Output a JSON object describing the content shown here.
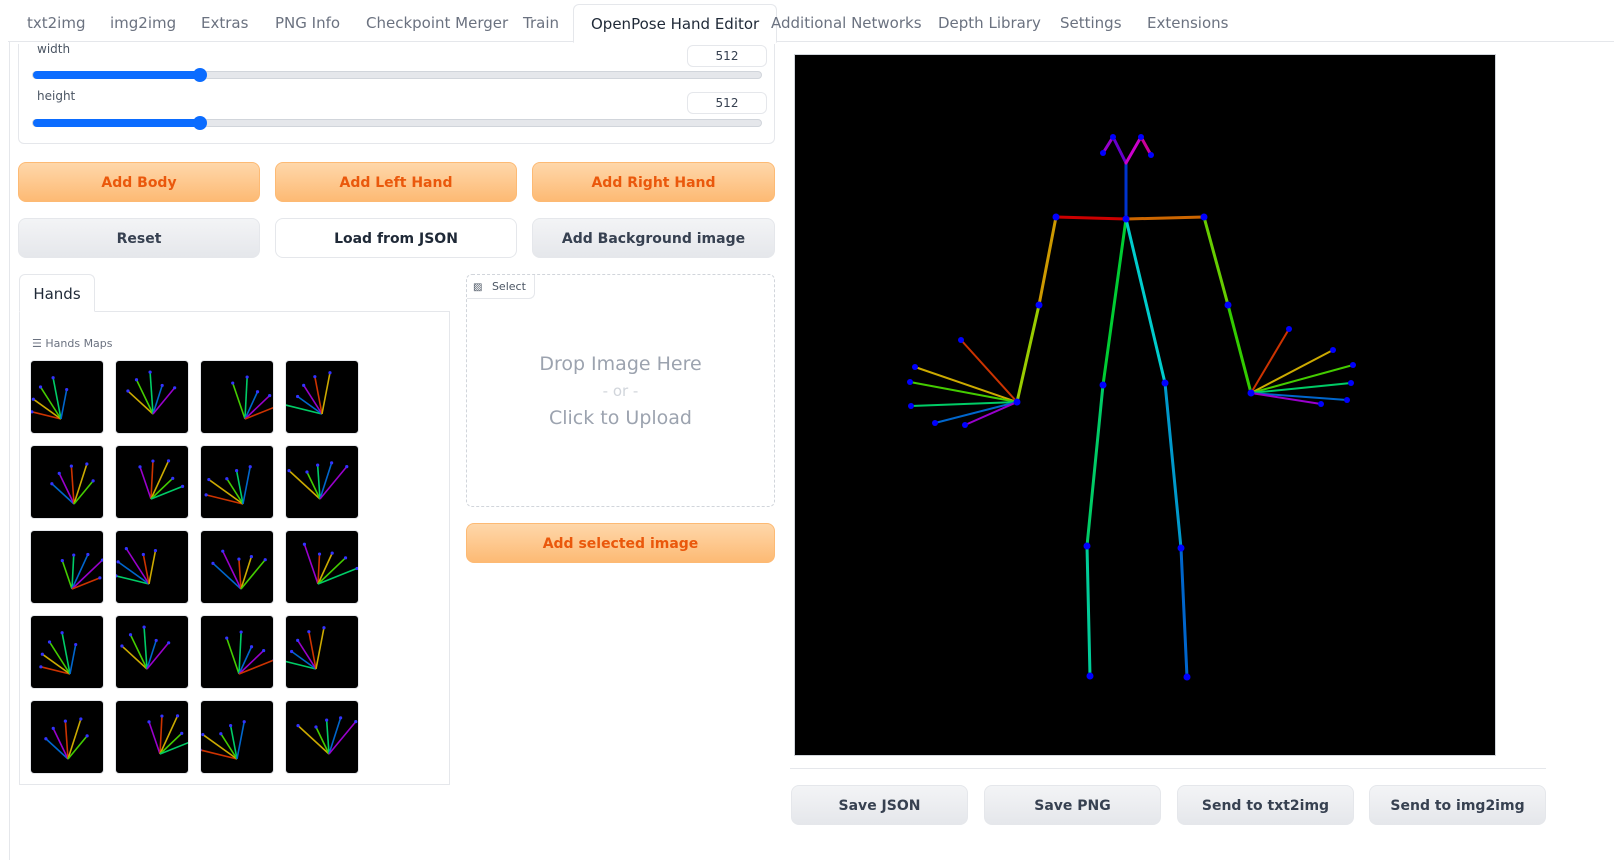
{
  "tabs": [
    {
      "label": "txt2img",
      "active": false
    },
    {
      "label": "img2img",
      "active": false
    },
    {
      "label": "Extras",
      "active": false
    },
    {
      "label": "PNG Info",
      "active": false
    },
    {
      "label": "Checkpoint Merger",
      "active": false
    },
    {
      "label": "Train",
      "active": false
    },
    {
      "label": "OpenPose Hand Editor",
      "active": true
    },
    {
      "label": "Additional Networks",
      "active": false
    },
    {
      "label": "Depth Library",
      "active": false
    },
    {
      "label": "Settings",
      "active": false
    },
    {
      "label": "Extensions",
      "active": false
    }
  ],
  "sliders": {
    "width": {
      "label": "width",
      "value": "512",
      "fraction": 0.23
    },
    "height": {
      "label": "height",
      "value": "512",
      "fraction": 0.23
    }
  },
  "buttons": {
    "add_body": "Add Body",
    "add_left_hand": "Add Left Hand",
    "add_right_hand": "Add Right Hand",
    "reset": "Reset",
    "load_json": "Load from JSON",
    "add_background": "Add Background image",
    "add_selected": "Add selected image",
    "save_json": "Save JSON",
    "save_png": "Save PNG",
    "send_txt2img": "Send to txt2img",
    "send_img2img": "Send to img2img"
  },
  "hands": {
    "tab_label": "Hands",
    "maps_label": "Hands Maps"
  },
  "upload": {
    "select_label": "Select",
    "drop_text": "Drop Image Here",
    "or_text": "- or -",
    "click_text": "Click to Upload"
  },
  "colors": {
    "accent_orange": "#ea580c",
    "slider_blue": "#0b6cff",
    "canvas_bg": "#000000",
    "joint_blue": "#0000ff"
  }
}
